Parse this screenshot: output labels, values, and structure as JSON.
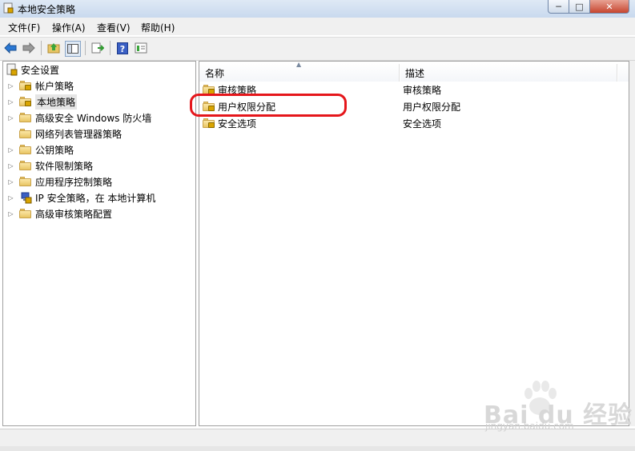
{
  "window": {
    "title": "本地安全策略"
  },
  "menu": [
    {
      "label": "文件(F)"
    },
    {
      "label": "操作(A)"
    },
    {
      "label": "查看(V)"
    },
    {
      "label": "帮助(H)"
    }
  ],
  "toolbar": {
    "buttons": [
      {
        "icon": "back-arrow-icon"
      },
      {
        "icon": "forward-arrow-icon"
      },
      {
        "icon": "up-folder-icon"
      },
      {
        "icon": "show-hide-tree-icon"
      },
      {
        "icon": "export-list-icon"
      },
      {
        "icon": "help-icon"
      },
      {
        "icon": "properties-icon"
      }
    ]
  },
  "tree": {
    "root": {
      "label": "安全设置"
    },
    "items": [
      {
        "label": "帐户策略",
        "folder": "locked"
      },
      {
        "label": "本地策略",
        "folder": "locked",
        "selected": true
      },
      {
        "label": "高级安全 Windows 防火墙",
        "folder": "plain"
      },
      {
        "label": "网络列表管理器策略",
        "folder": "plain"
      },
      {
        "label": "公钥策略",
        "folder": "plain"
      },
      {
        "label": "软件限制策略",
        "folder": "plain"
      },
      {
        "label": "应用程序控制策略",
        "folder": "plain"
      },
      {
        "label": "IP 安全策略，在 本地计算机",
        "folder": "ip"
      },
      {
        "label": "高级审核策略配置",
        "folder": "plain"
      }
    ]
  },
  "list": {
    "columns": [
      {
        "label": "名称"
      },
      {
        "label": "描述"
      }
    ],
    "rows": [
      {
        "name": "审核策略",
        "desc": "审核策略"
      },
      {
        "name": "用户权限分配",
        "desc": "用户权限分配"
      },
      {
        "name": "安全选项",
        "desc": "安全选项"
      }
    ],
    "highlighted_row": "用户权限分配"
  },
  "watermark": {
    "brand": "Bai du 经验",
    "url": "jingyan.baidu.com"
  },
  "colors": {
    "highlight_ring": "#e5161b",
    "titlebar": "#c9d9ee",
    "folder": "#e8c564"
  }
}
